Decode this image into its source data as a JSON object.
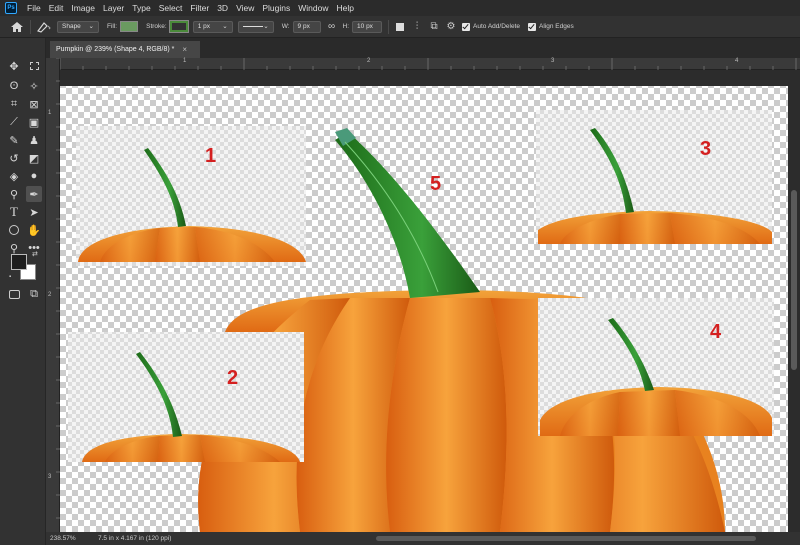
{
  "menubar": {
    "logo": "Ps",
    "items": [
      "File",
      "Edit",
      "Image",
      "Layer",
      "Type",
      "Select",
      "Filter",
      "3D",
      "View",
      "Plugins",
      "Window",
      "Help"
    ]
  },
  "options": {
    "mode": "Shape",
    "fill_label": "Fill:",
    "stroke_label": "Stroke:",
    "stroke_width": "1 px",
    "w_label": "W:",
    "w_value": "9 px",
    "h_label": "H:",
    "h_value": "10 px",
    "auto_add_delete": "Auto Add/Delete",
    "align_edges": "Align Edges",
    "fill_color": "#6a9a60",
    "stroke_color": "#4a8a3a"
  },
  "document": {
    "tab_title": "Pumpkin @ 239% (Shape 4, RGB/8) *",
    "tab_close": "×"
  },
  "rulers": {
    "top": [
      "1",
      "2",
      "3",
      "4"
    ],
    "left": [
      "1",
      "2",
      "3"
    ]
  },
  "canvas": {
    "labels": [
      "1",
      "2",
      "3",
      "4",
      "5"
    ],
    "label_color": "#d42020"
  },
  "status": {
    "zoom": "238.57%",
    "doc_info": "7.5 in x 4.167 in (120 ppi)"
  }
}
